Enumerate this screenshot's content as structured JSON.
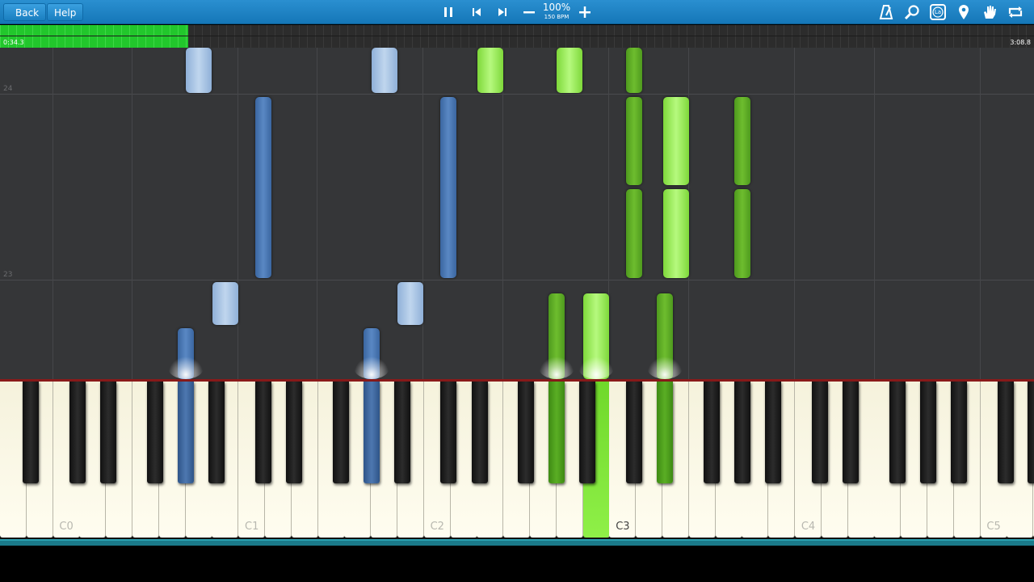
{
  "toolbar": {
    "back_label": "Back",
    "help_label": "Help",
    "speed_percent": "100%",
    "tempo": "150 BPM",
    "icons": [
      "pause-icon",
      "skip-back-icon",
      "skip-forward-icon",
      "minus-icon",
      "plus-icon",
      "metronome-icon",
      "search-icon",
      "learn-icon",
      "pin-icon",
      "hand-icon",
      "loop-icon"
    ],
    "learn_badge": "La"
  },
  "timeline": {
    "current_time": "0:34.3",
    "total_time": "3:08.8",
    "progress": 0.182
  },
  "roll": {
    "measure_labels": [
      "24",
      "23"
    ]
  },
  "keyboard": {
    "octave_labels": [
      "C0",
      "C1",
      "C2",
      "C3",
      "C4",
      "C5"
    ],
    "highlighted_label": "C3"
  },
  "colors": {
    "left_hand_black": "#4a76b0",
    "left_hand_white": "#a8c4e6",
    "right_hand_black": "#5eac26",
    "right_hand_white": "#9cf05a",
    "toolbar": "#1a7fc0",
    "progress": "#22c72c"
  }
}
